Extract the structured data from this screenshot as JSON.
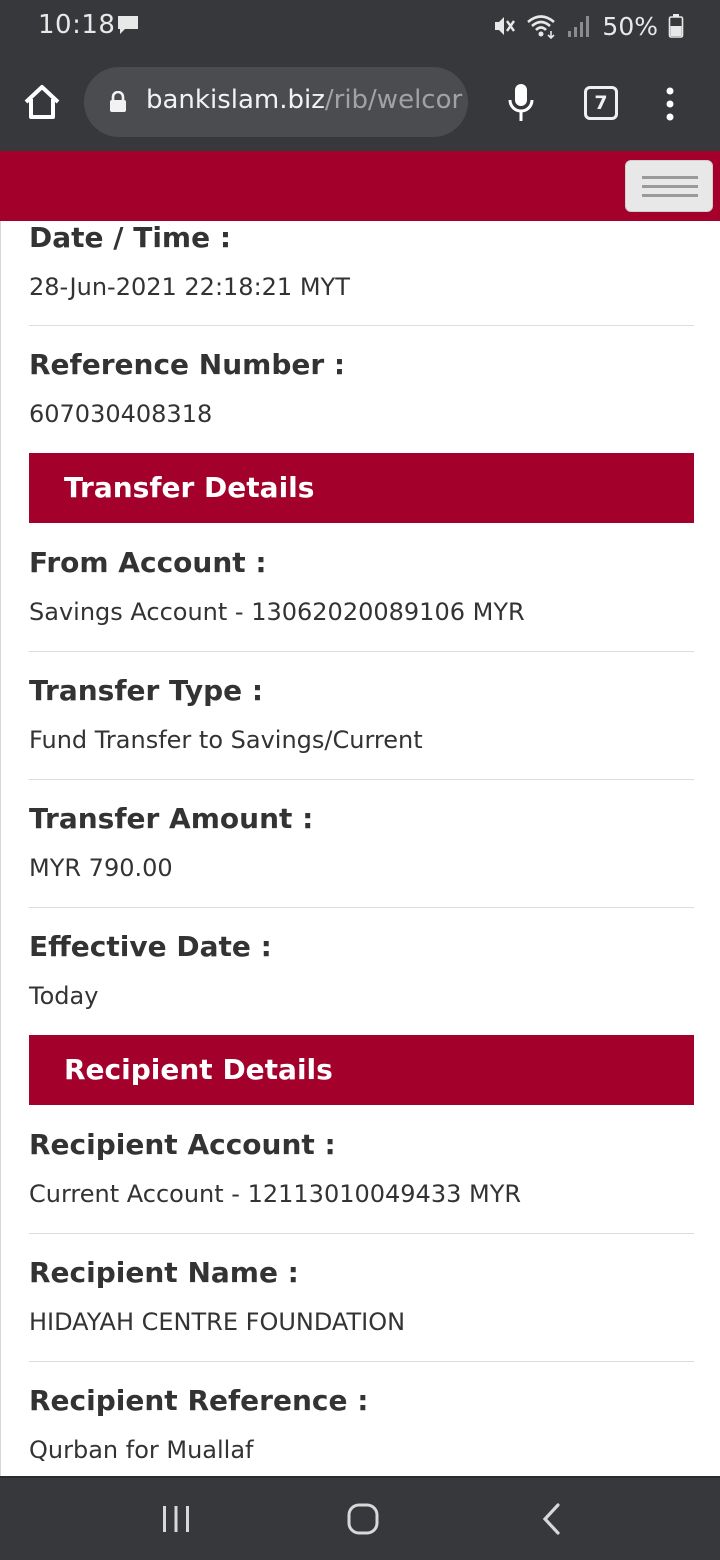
{
  "status_bar": {
    "time": "10:18",
    "battery": "50%",
    "icons": [
      "message-icon",
      "mute-icon",
      "wifi-icon",
      "signal-icon",
      "battery-icon"
    ]
  },
  "browser": {
    "url_host": "bankislam.biz",
    "url_path": "/rib/welcor",
    "tab_count": "7"
  },
  "receipt": {
    "date_time_label": "Date / Time :",
    "date_time_value": "28-Jun-2021 22:18:21 MYT",
    "reference_label": "Reference Number :",
    "reference_value": "607030408318"
  },
  "transfer_details": {
    "title": "Transfer Details",
    "from_account_label": "From Account :",
    "from_account_value": "Savings Account - 13062020089106 MYR",
    "transfer_type_label": "Transfer Type :",
    "transfer_type_value": "Fund Transfer to Savings/Current",
    "transfer_amount_label": "Transfer Amount :",
    "transfer_amount_value": "MYR 790.00",
    "effective_date_label": "Effective Date :",
    "effective_date_value": "Today"
  },
  "recipient_details": {
    "title": "Recipient Details",
    "account_label": "Recipient Account :",
    "account_value": "Current Account - 12113010049433 MYR",
    "name_label": "Recipient Name :",
    "name_value": "HIDAYAH CENTRE FOUNDATION",
    "reference_label": "Recipient Reference :",
    "reference_value": "Qurban for Muallaf"
  },
  "colors": {
    "brand": "#a3002b",
    "system_bar": "#36383c",
    "text": "#333333"
  }
}
